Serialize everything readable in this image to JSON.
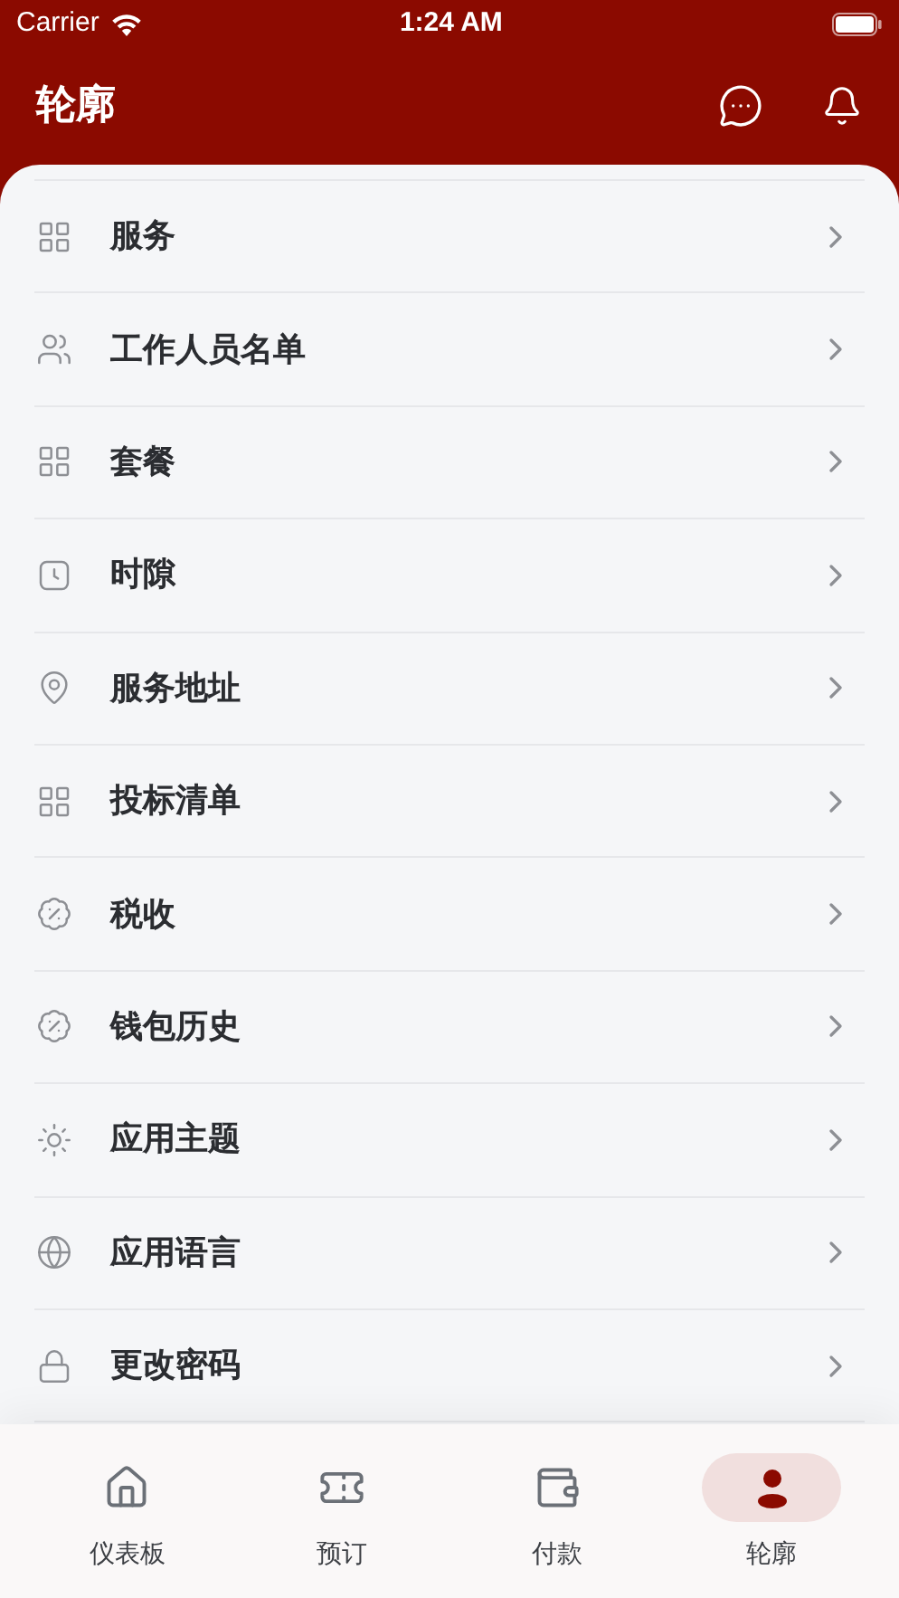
{
  "status_bar": {
    "carrier": "Carrier",
    "time": "1:24 AM"
  },
  "header": {
    "title": "轮廓"
  },
  "menu": [
    {
      "label": "服务"
    },
    {
      "label": "工作人员名单"
    },
    {
      "label": "套餐"
    },
    {
      "label": "时隙"
    },
    {
      "label": "服务地址"
    },
    {
      "label": "投标清单"
    },
    {
      "label": "税收"
    },
    {
      "label": "钱包历史"
    },
    {
      "label": "应用主题"
    },
    {
      "label": "应用语言"
    },
    {
      "label": "更改密码"
    }
  ],
  "tab_bar": [
    {
      "label": "仪表板",
      "selected": false
    },
    {
      "label": "预订",
      "selected": false
    },
    {
      "label": "付款",
      "selected": false
    },
    {
      "label": "轮廓",
      "selected": true
    }
  ]
}
